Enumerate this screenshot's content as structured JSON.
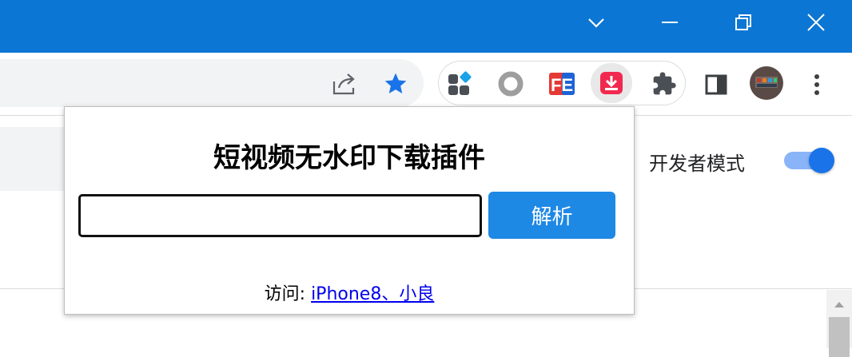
{
  "window": {
    "controls": [
      "tab-search",
      "minimize",
      "restore",
      "close"
    ]
  },
  "toolbar": {
    "icons": [
      "share-icon",
      "bookmark-star-icon",
      "extension-grid-icon",
      "extension-circle-icon",
      "extension-fe-icon",
      "extension-download-icon",
      "extensions-puzzle-icon",
      "side-panel-icon",
      "profile-avatar",
      "more-menu-icon"
    ],
    "fe_label": "FE",
    "accent": "#0c76d4"
  },
  "popup": {
    "title": "短视频无水印下载插件",
    "input_value": "",
    "parse_button": "解析",
    "visit_prefix": "访问: ",
    "visit_link": "iPhone8、小良"
  },
  "page": {
    "dev_mode_label": "开发者模式",
    "dev_mode_enabled": true
  }
}
